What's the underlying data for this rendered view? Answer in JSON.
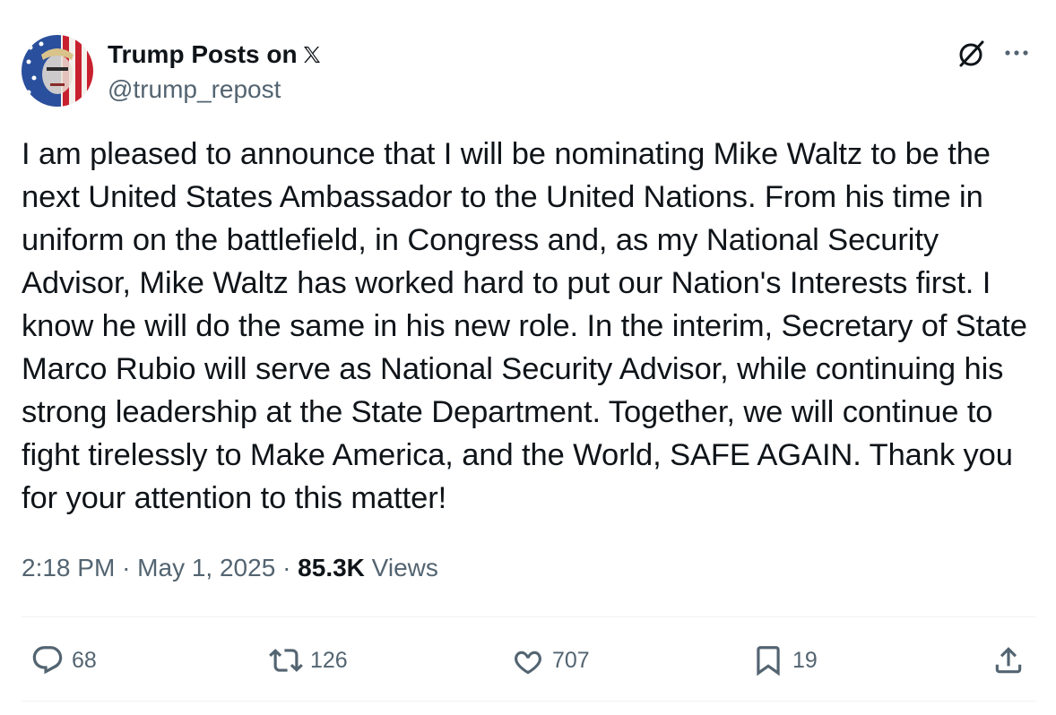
{
  "author": {
    "display_name": "Trump Posts on",
    "handle": "@trump_repost",
    "avatar_icon": "flag-portrait-avatar",
    "badge_icon": "x-logo-icon"
  },
  "header_actions": {
    "grok_icon": "grok-slash-circle-icon",
    "more_icon": "more-dots-icon"
  },
  "tweet": {
    "text": "I am pleased to announce that I will be nominating Mike Waltz to be the next United States Ambassador to the United Nations. From his time in uniform on the battlefield, in Congress and, as my National Security Advisor, Mike Waltz has worked hard to put our Nation's Interests first. I know he will do the same in his new role. In the interim, Secretary of State Marco Rubio will serve as National Security Advisor, while continuing his strong leadership at the State Department. Together, we will continue to fight tirelessly to Make America, and the World, SAFE AGAIN. Thank you for your attention to this matter!"
  },
  "meta": {
    "time": "2:18 PM",
    "separator": "·",
    "date": "May 1, 2025",
    "views_count": "85.3K",
    "views_label": "Views"
  },
  "actions": {
    "replies": "68",
    "reposts": "126",
    "likes": "707",
    "bookmarks": "19"
  },
  "colors": {
    "text": "#0f1419",
    "secondary": "#536471",
    "divider": "#eff3f4"
  }
}
